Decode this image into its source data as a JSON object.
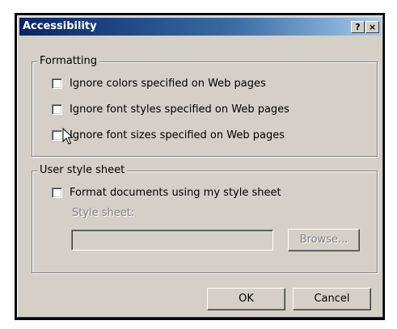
{
  "window": {
    "title": "Accessibility",
    "help_label": "?",
    "close_label": "×"
  },
  "formatting": {
    "legend": "Formatting",
    "options": [
      {
        "label": "Ignore colors specified on Web pages",
        "checked": false
      },
      {
        "label": "Ignore font styles specified on Web pages",
        "checked": false
      },
      {
        "label": "Ignore font sizes specified on Web pages",
        "checked": false
      }
    ]
  },
  "user_style": {
    "legend": "User style sheet",
    "option_label": "Format documents using my style sheet",
    "sheet_label": "Style sheet:",
    "sheet_value": "",
    "browse_label": "Browse..."
  },
  "buttons": {
    "ok": "OK",
    "cancel": "Cancel"
  }
}
